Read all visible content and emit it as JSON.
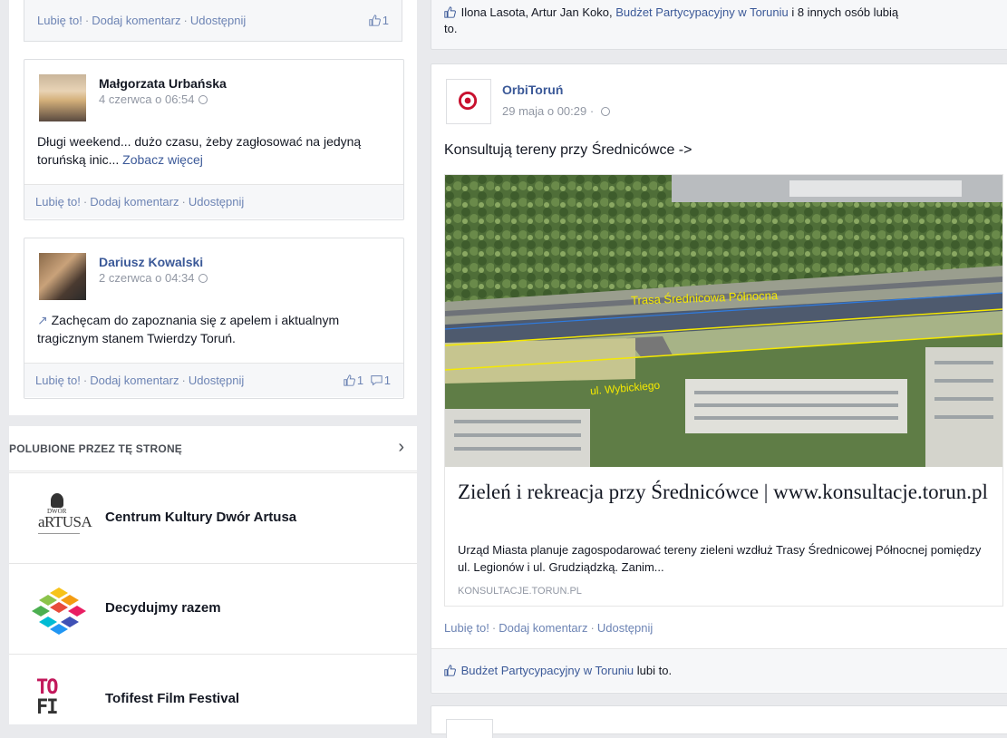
{
  "actions": {
    "like": "Lubię to!",
    "comment": "Dodaj komentarz",
    "share": "Udostępnij",
    "sep": "·"
  },
  "left_top_bar": {
    "likes": "1"
  },
  "posts_left": [
    {
      "author": "Małgorzata Urbańska",
      "time": "4 czerwca o 06:54",
      "text": "Długi weekend... dużo czasu, żeby zagłosować na jedyną toruńską inic...",
      "more": "Zobacz więcej"
    },
    {
      "author": "Dariusz Kowalski",
      "time": "2 czerwca o 04:34",
      "text": "Zachęcam do zapoznania się z apelem i aktualnym tragicznym stanem Twierdzy Toruń.",
      "likes": "1",
      "comments": "1"
    }
  ],
  "liked_pages": {
    "header": "POLUBIONE PRZEZ TĘ STRONĘ",
    "items": [
      {
        "name": "Centrum Kultury Dwór Artusa",
        "logo_top": "DWÓR",
        "logo_main": "aRTUSA"
      },
      {
        "name": "Decydujmy razem"
      },
      {
        "name": "Tofifest Film Festival",
        "logo_top": "TO",
        "logo_main": "FI"
      }
    ]
  },
  "right_top": {
    "likers_names": "Ilona Lasota, Artur Jan Koko,",
    "likers_page": "Budżet Partycypacyjny w Toruniu",
    "likers_rest": "i 8 innych osób lubią",
    "likers_rest2": "to."
  },
  "main_post": {
    "author": "OrbiToruń",
    "time": "29 maja o 00:29",
    "text": "Konsultują tereny przy Średnicówce ->",
    "image_labels": {
      "road": "Trasa Średnicowa Północna",
      "street": "ul. Wybickiego"
    },
    "link_title": "Zieleń i rekreacja przy Średnicówce | www.konsultacje.torun.pl",
    "link_desc": "Urząd Miasta planuje zagospodarować tereny zieleni wzdłuż Trasy Średnicowej Północnej pomiędzy ul. Legionów i ul. Grudziądzką. Zanim...",
    "link_domain": "KONSULTACJE.TORUN.PL",
    "liked_by_page": "Budżet Partycypacyjny w Toruniu",
    "liked_by_suffix": "lubi to."
  },
  "colors": {
    "link": "#3b5998",
    "accent": "#6d84b4",
    "orbi_red": "#c8102e"
  }
}
